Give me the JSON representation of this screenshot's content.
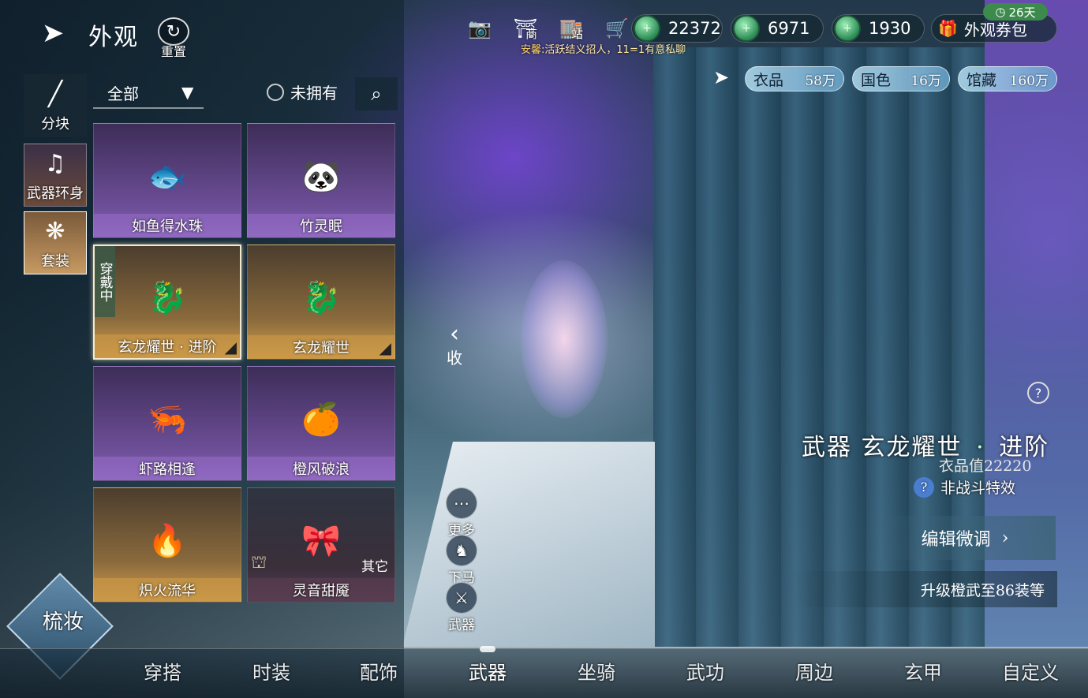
{
  "header": {
    "back_icon": "back-arrow-icon",
    "title": "外观",
    "reset_label": "重置",
    "top_icons": [
      {
        "name": "camera-icon",
        "glyph": "📷",
        "sub": ""
      },
      {
        "name": "shop-icon",
        "glyph": "⛩",
        "sub": "商"
      },
      {
        "name": "station-icon",
        "glyph": "🏬",
        "sub": "站"
      },
      {
        "name": "cart-icon",
        "glyph": "🛒",
        "sub": ""
      }
    ],
    "currencies": [
      {
        "value": "22372"
      },
      {
        "value": "6971"
      },
      {
        "value": "1930"
      }
    ],
    "notice_tag": "安馨",
    "notice_text": ":活跃结义招人，11=1有意私聊",
    "ticket_pack_label": "外观券包",
    "days_badge": "26天"
  },
  "stats": [
    {
      "label": "衣品",
      "value": "58万"
    },
    {
      "label": "国色",
      "value": "16万"
    },
    {
      "label": "馆藏",
      "value": "160万"
    }
  ],
  "filters": {
    "all_label": "全部",
    "unowned_label": "未拥有"
  },
  "side_categories": [
    {
      "label": "分块"
    },
    {
      "label": "武器环身"
    },
    {
      "label": "套装"
    }
  ],
  "items": [
    {
      "name": "如鱼得水珠",
      "style": "purple",
      "glyph": "🐟",
      "wearing": "",
      "other": "",
      "locked": false
    },
    {
      "name": "竹灵眠",
      "style": "purple",
      "glyph": "🐼",
      "wearing": "",
      "other": "",
      "locked": false
    },
    {
      "name": "玄龙耀世 · 进阶",
      "style": "gold",
      "glyph": "🐉",
      "wearing": "穿戴中",
      "other": "",
      "locked": false
    },
    {
      "name": "玄龙耀世",
      "style": "gold",
      "glyph": "🐉",
      "wearing": "",
      "other": "",
      "locked": false
    },
    {
      "name": "虾路相逢",
      "style": "purple",
      "glyph": "🦐",
      "wearing": "",
      "other": "",
      "locked": false
    },
    {
      "name": "橙风破浪",
      "style": "purple",
      "glyph": "🍊",
      "wearing": "",
      "other": "",
      "locked": false
    },
    {
      "name": "炽火流华",
      "style": "gold",
      "glyph": "🔥",
      "wearing": "",
      "other": "",
      "locked": false
    },
    {
      "name": "灵音甜魇",
      "style": "dark",
      "glyph": "🎀",
      "wearing": "",
      "other": "其它",
      "locked": true
    }
  ],
  "collapse_label": "收",
  "actions": [
    {
      "label": "更多",
      "glyph": "⋯"
    },
    {
      "label": "下马",
      "glyph": "♞"
    },
    {
      "label": "武器",
      "glyph": "⚔"
    }
  ],
  "detail": {
    "category": "武器",
    "name": "玄龙耀世",
    "suffix": "进阶",
    "quality_value": "衣品值22220",
    "noncombat_label": "非战斗特效",
    "edit_label": "编辑微调",
    "upgrade_hint": "升级橙武至86装等"
  },
  "makeup_label": "梳妆",
  "bottom_nav": [
    {
      "label": "穿搭",
      "active": false
    },
    {
      "label": "时装",
      "active": false
    },
    {
      "label": "配饰",
      "active": false
    },
    {
      "label": "武器",
      "active": true
    },
    {
      "label": "坐骑",
      "active": false
    },
    {
      "label": "武功",
      "active": false
    },
    {
      "label": "周边",
      "active": false
    },
    {
      "label": "玄甲",
      "active": false
    },
    {
      "label": "自定义",
      "active": false
    }
  ]
}
